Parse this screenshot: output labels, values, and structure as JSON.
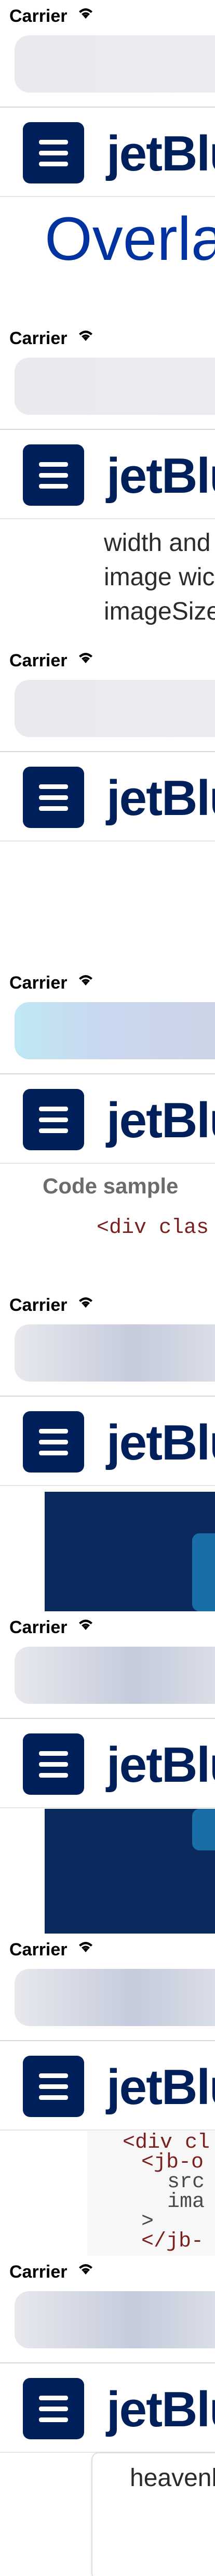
{
  "status": {
    "carrier": "Carrier"
  },
  "header": {
    "logo_text": "jetBlue"
  },
  "frames": [
    {
      "title": "Overla"
    },
    {
      "lines": [
        "width and",
        "image wic",
        "imageSize"
      ]
    },
    {},
    {
      "section_label": "Code sample",
      "code": [
        "<div clas"
      ]
    },
    {},
    {},
    {
      "code": [
        "<div cl",
        "<jb-o",
        "src",
        "ima",
        ">",
        "</jb-"
      ]
    },
    {
      "footer_text": "heavenl"
    }
  ],
  "colors": {
    "brand_navy": "#00205b",
    "title_blue": "#0033a0"
  }
}
